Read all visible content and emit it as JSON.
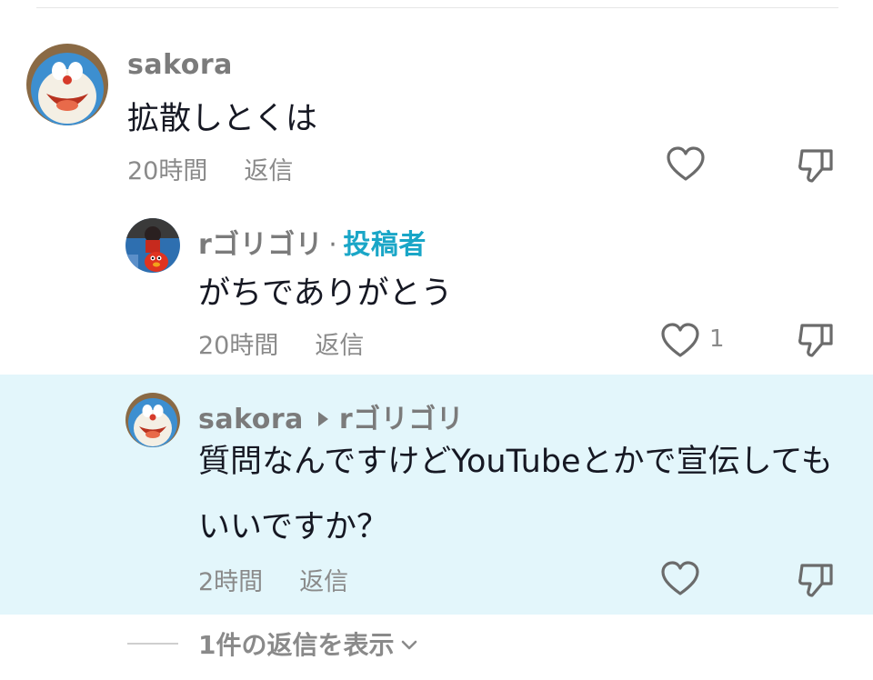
{
  "comments": [
    {
      "username": "sakora",
      "text": "拡散しとくは",
      "time": "20時間",
      "reply_label": "返信",
      "like_count": ""
    },
    {
      "username": "rゴリゴリ",
      "separator": "·",
      "author_badge": "投稿者",
      "text": "がちでありがとう",
      "time": "20時間",
      "reply_label": "返信",
      "like_count": "1"
    },
    {
      "username": "sakora",
      "reply_to": "rゴリゴリ",
      "text": "質問なんですけどYouTubeとかで宣伝してもいいですか？",
      "time": "2時間",
      "reply_label": "返信",
      "like_count": ""
    }
  ],
  "view_replies": {
    "label": "1件の返信を表示"
  },
  "colors": {
    "highlight_bg": "#e3f6fb",
    "author_badge": "#1aa6c7",
    "muted_text": "#8a8a8a"
  }
}
